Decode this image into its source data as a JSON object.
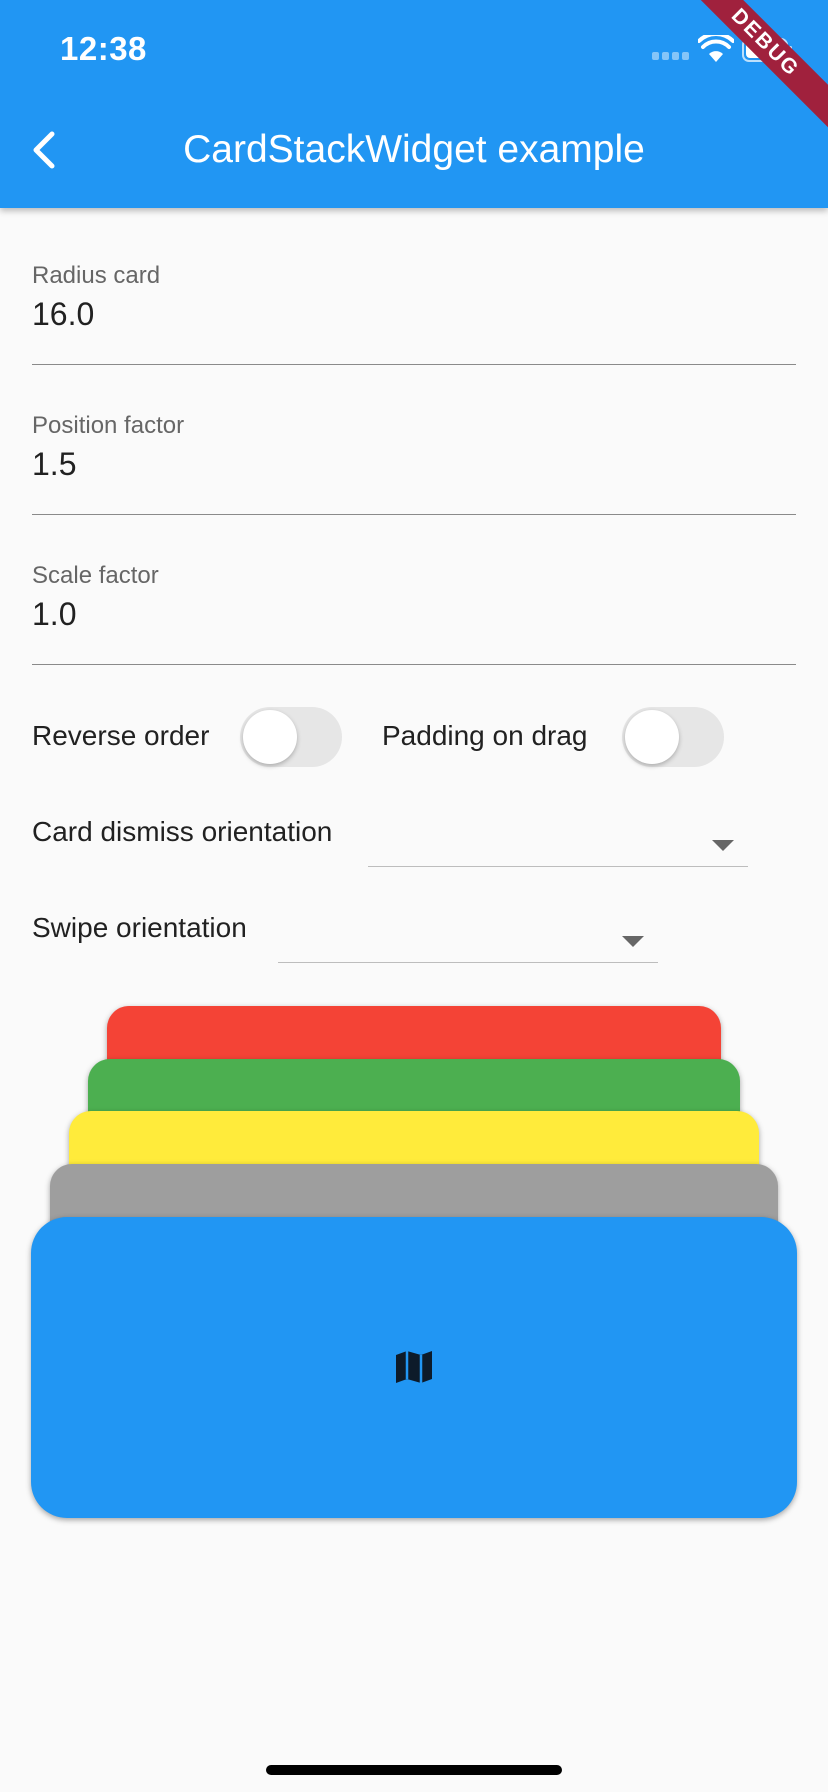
{
  "status_bar": {
    "time": "12:38"
  },
  "app_bar": {
    "title": "CardStackWidget example",
    "debug_banner": "DEBUG"
  },
  "fields": [
    {
      "label": "Radius card",
      "value": "16.0"
    },
    {
      "label": "Position factor",
      "value": "1.5"
    },
    {
      "label": "Scale factor",
      "value": "1.0"
    }
  ],
  "toggles": [
    {
      "label": "Reverse order",
      "on": false
    },
    {
      "label": "Padding on drag",
      "on": false
    }
  ],
  "dropdowns": [
    {
      "label": "Card dismiss orientation",
      "value": ""
    },
    {
      "label": "Swipe orientation",
      "value": ""
    }
  ],
  "cards": [
    {
      "color": "#f44336"
    },
    {
      "color": "#4caf50"
    },
    {
      "color": "#ffeb3b"
    },
    {
      "color": "#9e9e9e"
    },
    {
      "color": "#2196f3",
      "icon": "map-icon"
    }
  ],
  "colors": {
    "primary": "#2196f3",
    "background": "#fafafa"
  }
}
